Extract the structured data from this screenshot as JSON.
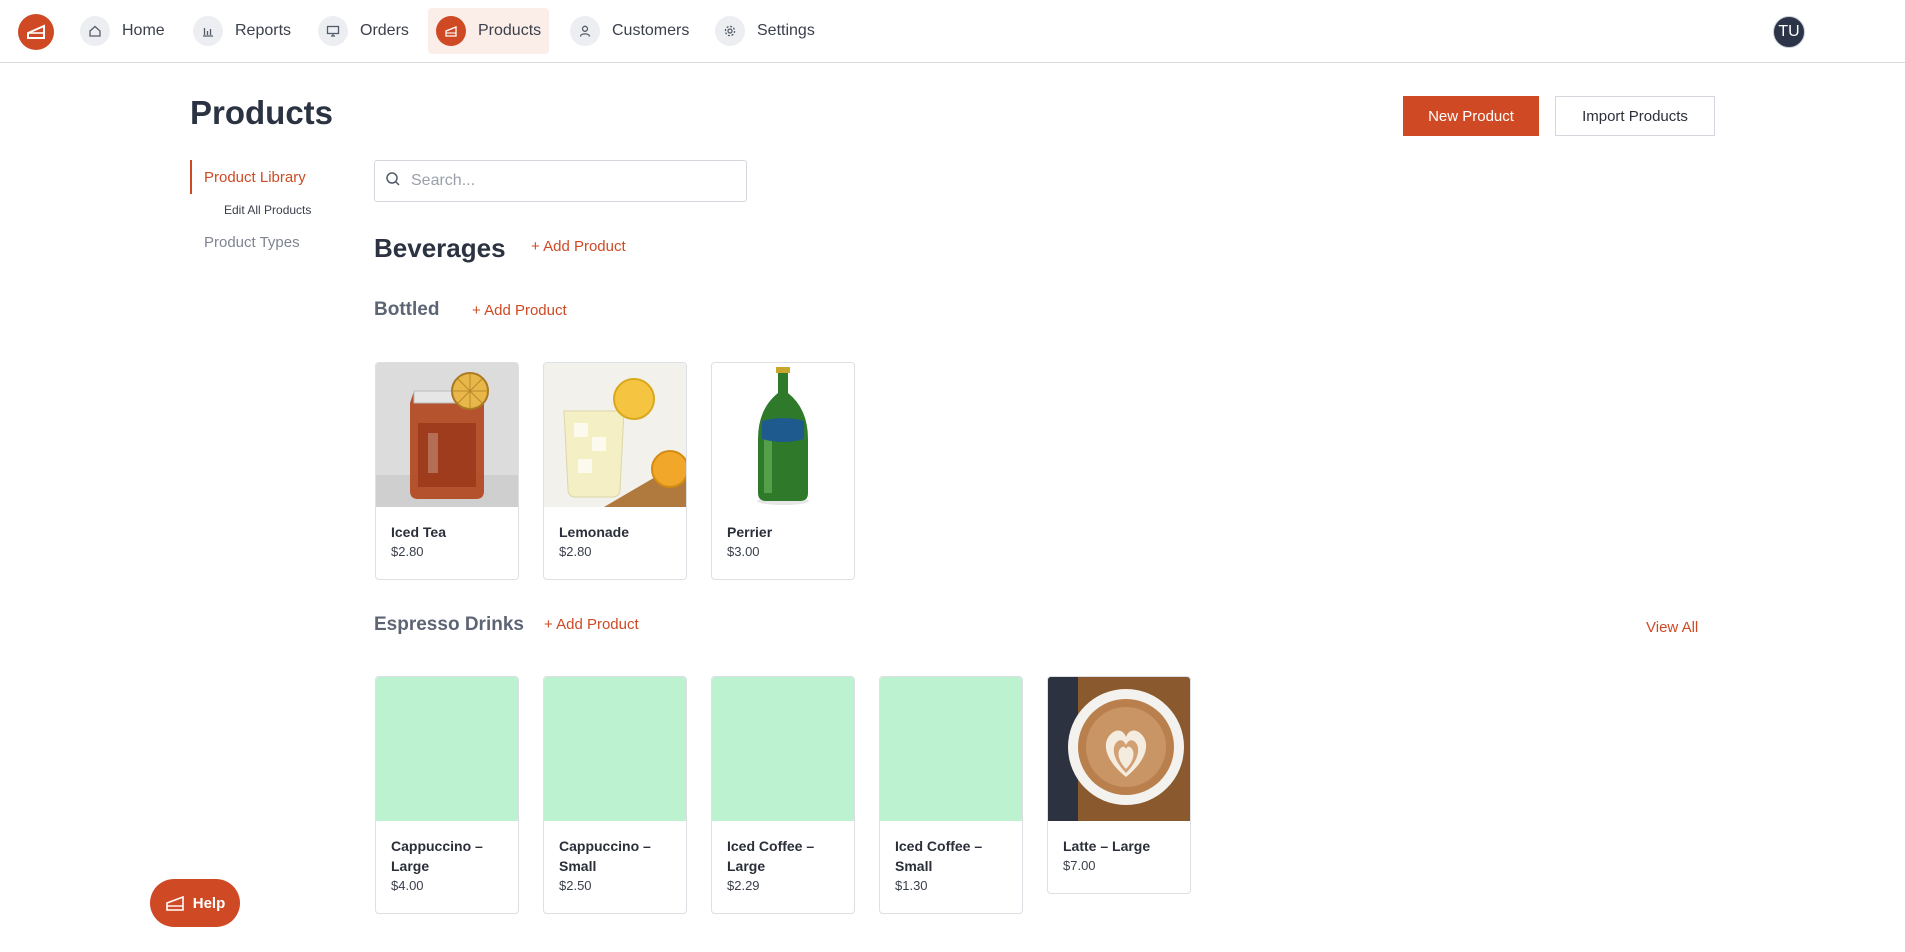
{
  "nav": {
    "items": [
      {
        "label": "Home",
        "icon": "home-icon"
      },
      {
        "label": "Reports",
        "icon": "bar-chart-icon"
      },
      {
        "label": "Orders",
        "icon": "monitor-icon"
      },
      {
        "label": "Products",
        "icon": "cake-icon",
        "active": true
      },
      {
        "label": "Customers",
        "icon": "user-icon"
      },
      {
        "label": "Settings",
        "icon": "gear-icon"
      }
    ],
    "avatar_initials": "TU"
  },
  "page": {
    "title": "Products",
    "new_button": "New Product",
    "import_button": "Import Products"
  },
  "sidebar": {
    "active": "Product Library",
    "sub": "Edit All Products",
    "item": "Product Types"
  },
  "search": {
    "placeholder": "Search..."
  },
  "category": {
    "name": "Beverages",
    "add_label": "+ Add Product"
  },
  "groups": {
    "bottled": {
      "name": "Bottled",
      "add_label": "+ Add Product",
      "products": [
        {
          "name": "Iced Tea",
          "price": "$2.80",
          "image": "iced-tea"
        },
        {
          "name": "Lemonade",
          "price": "$2.80",
          "image": "lemonade"
        },
        {
          "name": "Perrier",
          "price": "$3.00",
          "image": "perrier"
        }
      ]
    },
    "espresso": {
      "name": "Espresso Drinks",
      "add_label": "+ Add Product",
      "view_all": "View All",
      "products": [
        {
          "name": "Cappuccino – Large",
          "price": "$4.00",
          "image": "placeholder"
        },
        {
          "name": "Cappuccino – Small",
          "price": "$2.50",
          "image": "placeholder"
        },
        {
          "name": "Iced Coffee – Large",
          "price": "$2.29",
          "image": "placeholder"
        },
        {
          "name": "Iced Coffee – Small",
          "price": "$1.30",
          "image": "placeholder"
        },
        {
          "name": "Latte – Large",
          "price": "$7.00",
          "image": "latte"
        }
      ]
    }
  },
  "help": {
    "label": "Help"
  },
  "colors": {
    "accent": "#cf4a24",
    "placeholder_image": "#bcf2cf"
  }
}
